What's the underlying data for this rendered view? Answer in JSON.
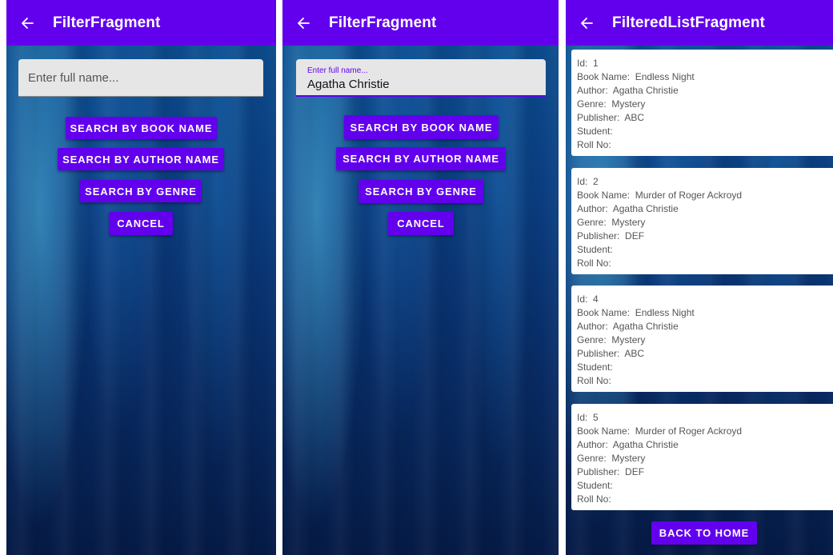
{
  "colors": {
    "primary": "#6200ee",
    "field_bg": "#e6e6e6",
    "card_bg": "#ffffff"
  },
  "back_icon": "arrow-left-icon",
  "screen1": {
    "title": "FilterFragment",
    "search_placeholder": "Enter full name...",
    "buttons": {
      "book": "Search by book name",
      "author": "Search by author name",
      "genre": "Search by genre",
      "cancel": "Cancel"
    }
  },
  "screen2": {
    "title": "FilterFragment",
    "field_label": "Enter full name...",
    "field_value": "Agatha Christie",
    "buttons": {
      "book": "Search by book name",
      "author": "Search by author name",
      "genre": "Search by genre",
      "cancel": "Cancel"
    }
  },
  "screen3": {
    "title": "FilteredListFragment",
    "labels": {
      "id": "Id:",
      "book": "Book Name:",
      "author": "Author:",
      "genre": "Genre:",
      "publisher": "Publisher:",
      "student": "Student:",
      "roll": "Roll No:"
    },
    "items": [
      {
        "id": "1",
        "book": "Endless Night",
        "author": "Agatha Christie",
        "genre": "Mystery",
        "publisher": "ABC",
        "student": "",
        "roll": ""
      },
      {
        "id": "2",
        "book": "Murder of Roger Ackroyd",
        "author": "Agatha Christie",
        "genre": "Mystery",
        "publisher": "DEF",
        "student": "",
        "roll": ""
      },
      {
        "id": "4",
        "book": "Endless Night",
        "author": "Agatha Christie",
        "genre": "Mystery",
        "publisher": "ABC",
        "student": "",
        "roll": ""
      },
      {
        "id": "5",
        "book": "Murder of Roger Ackroyd",
        "author": "Agatha Christie",
        "genre": "Mystery",
        "publisher": "DEF",
        "student": "",
        "roll": ""
      }
    ],
    "back_home": "Back to home"
  }
}
